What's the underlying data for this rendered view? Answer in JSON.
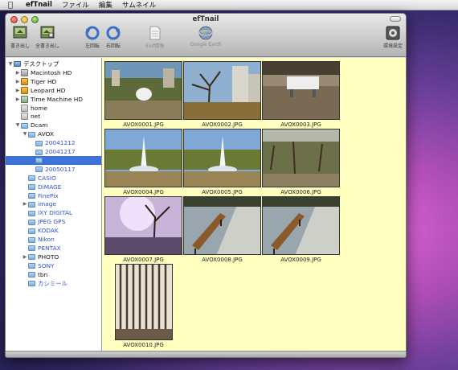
{
  "menubar": {
    "app_name": "efTnail",
    "items": [
      "ファイル",
      "編集",
      "サムネイル"
    ]
  },
  "window": {
    "title": "efTnail",
    "toolbar": [
      {
        "label": "書き出し",
        "icon": "export-icon",
        "enabled": true
      },
      {
        "label": "全書き出し",
        "icon": "export-all-icon",
        "enabled": true
      },
      {
        "label": "左回転",
        "icon": "rotate-left-icon",
        "enabled": true
      },
      {
        "label": "右回転",
        "icon": "rotate-right-icon",
        "enabled": true
      },
      {
        "label": "Exif情報",
        "icon": "exif-info-icon",
        "enabled": false
      },
      {
        "label": "Google Earth",
        "icon": "google-earth-icon",
        "enabled": false
      },
      {
        "label": "環境設定",
        "icon": "preferences-icon",
        "enabled": true
      }
    ]
  },
  "sidebar": {
    "items": [
      {
        "label": "デスクトップ",
        "indent": 0,
        "tri": "▼",
        "icon": "desktop-icon"
      },
      {
        "label": "Macintosh HD",
        "indent": 1,
        "tri": "▶",
        "icon": "hard-disk-icon"
      },
      {
        "label": "Tiger HD",
        "indent": 1,
        "tri": "▶",
        "icon": "hard-disk-orange-icon"
      },
      {
        "label": "Leopard HD",
        "indent": 1,
        "tri": "▶",
        "icon": "hard-disk-orange-icon"
      },
      {
        "label": "Time Machine HD",
        "indent": 1,
        "tri": "▶",
        "icon": "time-machine-disk-icon"
      },
      {
        "label": "home",
        "indent": 1,
        "tri": "",
        "icon": "home-folder-icon"
      },
      {
        "label": "net",
        "indent": 1,
        "tri": "",
        "icon": "network-folder-icon"
      },
      {
        "label": "Dcam",
        "indent": 1,
        "tri": "▼",
        "icon": "folder-icon"
      },
      {
        "label": "AVOX",
        "indent": 2,
        "tri": "▼",
        "icon": "folder-icon"
      },
      {
        "label": "20041212",
        "indent": 3,
        "tri": "",
        "icon": "folder-icon",
        "blue": true
      },
      {
        "label": "20041217",
        "indent": 3,
        "tri": "",
        "icon": "folder-icon",
        "blue": true
      },
      {
        "label": "20041218",
        "indent": 3,
        "tri": "",
        "icon": "folder-icon",
        "selected": true
      },
      {
        "label": "20050117",
        "indent": 3,
        "tri": "",
        "icon": "folder-icon",
        "blue": true
      },
      {
        "label": "CASIO",
        "indent": 2,
        "tri": "",
        "icon": "folder-icon",
        "blue": true
      },
      {
        "label": "DiMAGE",
        "indent": 2,
        "tri": "",
        "icon": "folder-icon",
        "blue": true
      },
      {
        "label": "FinePix",
        "indent": 2,
        "tri": "",
        "icon": "folder-icon",
        "blue": true
      },
      {
        "label": "image",
        "indent": 2,
        "tri": "▶",
        "icon": "folder-icon",
        "blue": true
      },
      {
        "label": "IXY DIGITAL",
        "indent": 2,
        "tri": "",
        "icon": "folder-icon",
        "blue": true
      },
      {
        "label": "JPEG GPS",
        "indent": 2,
        "tri": "",
        "icon": "folder-icon",
        "blue": true
      },
      {
        "label": "KODAK",
        "indent": 2,
        "tri": "",
        "icon": "folder-icon",
        "blue": true
      },
      {
        "label": "Nikon",
        "indent": 2,
        "tri": "",
        "icon": "folder-icon",
        "blue": true
      },
      {
        "label": "PENTAX",
        "indent": 2,
        "tri": "",
        "icon": "folder-icon",
        "blue": true
      },
      {
        "label": "PHOTO",
        "indent": 2,
        "tri": "▶",
        "icon": "folder-icon"
      },
      {
        "label": "SONY",
        "indent": 2,
        "tri": "",
        "icon": "folder-icon",
        "blue": true
      },
      {
        "label": "tbn",
        "indent": 2,
        "tri": "",
        "icon": "folder-icon"
      },
      {
        "label": "カシミール",
        "indent": 2,
        "tri": "",
        "icon": "folder-icon",
        "blue": true
      }
    ]
  },
  "thumbnails": [
    {
      "filename": "AVOX0001.JPG",
      "scene": "fountain-park"
    },
    {
      "filename": "AVOX0002.JPG",
      "scene": "bare-tree-buildings"
    },
    {
      "filename": "AVOX0003.JPG",
      "scene": "bench-sepia"
    },
    {
      "filename": "AVOX0004.JPG",
      "scene": "fountain-trees"
    },
    {
      "filename": "AVOX0005.JPG",
      "scene": "fountain-trees"
    },
    {
      "filename": "AVOX0006.JPG",
      "scene": "garden-trees"
    },
    {
      "filename": "AVOX0007.JPG",
      "scene": "purple-flare-tree"
    },
    {
      "filename": "AVOX0008.JPG",
      "scene": "bench-path"
    },
    {
      "filename": "AVOX0009.JPG",
      "scene": "bench-path"
    },
    {
      "filename": "AVOX0010.JPG",
      "scene": "curtain"
    }
  ],
  "colors": {
    "content_bg": "#ffffc0",
    "selection": "#3d73d8",
    "folder_link_blue": "#2f52d6"
  }
}
